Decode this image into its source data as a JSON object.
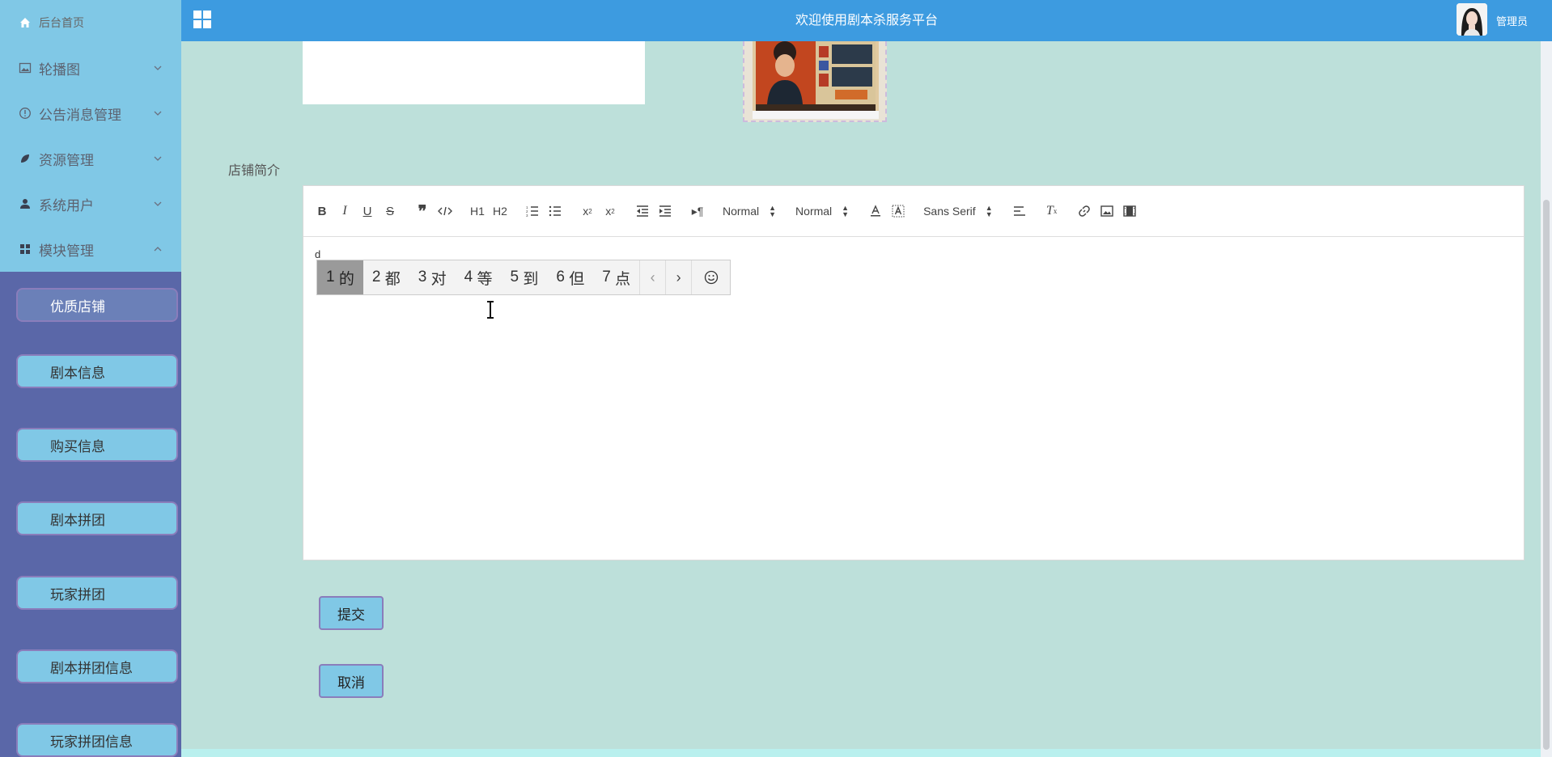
{
  "header": {
    "title": "欢迎使用剧本杀服务平台",
    "user_label": "管理员"
  },
  "sidebar": {
    "home": "后台首页",
    "menus": [
      {
        "label": "轮播图",
        "icon": "image-icon",
        "expanded": false
      },
      {
        "label": "公告消息管理",
        "icon": "info-circle-icon",
        "expanded": false
      },
      {
        "label": "资源管理",
        "icon": "leaf-icon",
        "expanded": false
      },
      {
        "label": "系统用户",
        "icon": "user-icon",
        "expanded": false
      },
      {
        "label": "模块管理",
        "icon": "grid-icon",
        "expanded": true
      }
    ],
    "submenu": [
      {
        "label": "优质店铺",
        "active": true
      },
      {
        "label": "剧本信息",
        "active": false
      },
      {
        "label": "购买信息",
        "active": false
      },
      {
        "label": "剧本拼团",
        "active": false
      },
      {
        "label": "玩家拼团",
        "active": false
      },
      {
        "label": "剧本拼团信息",
        "active": false
      },
      {
        "label": "玩家拼团信息",
        "active": false
      }
    ]
  },
  "form": {
    "intro_label": "店铺简介",
    "editor_text": "d",
    "toolbar": {
      "header_select": "Normal",
      "size_select": "Normal",
      "font_select": "Sans Serif",
      "h1": "H1",
      "h2": "H2"
    },
    "submit_label": "提交",
    "cancel_label": "取消"
  },
  "ime": {
    "candidates": [
      {
        "num": "1",
        "word": "的"
      },
      {
        "num": "2",
        "word": "都"
      },
      {
        "num": "3",
        "word": "对"
      },
      {
        "num": "4",
        "word": "等"
      },
      {
        "num": "5",
        "word": "到"
      },
      {
        "num": "6",
        "word": "但"
      },
      {
        "num": "7",
        "word": "点"
      }
    ]
  },
  "colors": {
    "topbar": "#3d9be0",
    "sidebar_top": "#80c8e6",
    "sidebar_bottom": "#5a67a8",
    "content_bg": "#bde0da"
  }
}
